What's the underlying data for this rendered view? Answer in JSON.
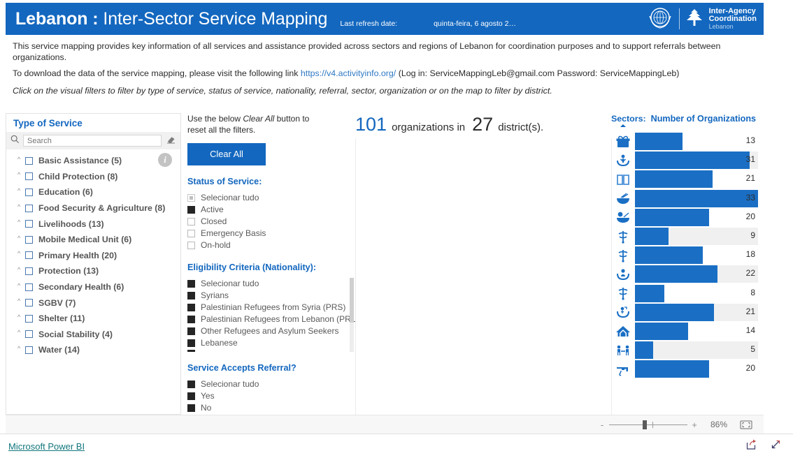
{
  "header": {
    "title_bold": "Lebanon :",
    "title_light": "Inter-Sector Service Mapping",
    "refresh_label": "Last refresh date:",
    "refresh_value": "quinta-feira, 6 agosto 2…",
    "logo": {
      "line1": "Inter-Agency",
      "line2": "Coordination",
      "line3": "Lebanon"
    },
    "accent_color": "#1367bf"
  },
  "intro": {
    "paragraph1": "This service mapping provides key information of all services and assistance provided across sectors and regions of Lebanon for coordination purposes and to support referrals between organizations.",
    "paragraph2_prefix": "To download the data of the service mapping, please visit the following link ",
    "paragraph2_link": "https://v4.activityinfo.org/",
    "paragraph2_suffix": " (Log in: ServiceMappingLeb@gmail.com Password: ServiceMappingLeb)",
    "paragraph3": "Click on the visual filters to filter by type of service, status of service, nationality, referral, sector, organization or on the map to filter by district."
  },
  "type_of_service": {
    "title": "Type of Service",
    "search_placeholder": "Search",
    "search_value": "",
    "info_glyph": "i",
    "items": [
      {
        "label": "Basic Assistance (5)",
        "checked": false
      },
      {
        "label": "Child Protection (8)",
        "checked": false
      },
      {
        "label": "Education (6)",
        "checked": false
      },
      {
        "label": "Food Security & Agriculture (8)",
        "checked": false
      },
      {
        "label": "Livelihoods (13)",
        "checked": false
      },
      {
        "label": "Mobile Medical Unit (6)",
        "checked": false
      },
      {
        "label": "Primary Health (20)",
        "checked": false
      },
      {
        "label": "Protection (13)",
        "checked": false
      },
      {
        "label": "Secondary Health (6)",
        "checked": false
      },
      {
        "label": "SGBV (7)",
        "checked": false
      },
      {
        "label": "Shelter (11)",
        "checked": false
      },
      {
        "label": "Social Stability (4)",
        "checked": false
      },
      {
        "label": "Water (14)",
        "checked": false
      }
    ]
  },
  "filters": {
    "hint_prefix": "Use the below ",
    "hint_italic": "Clear All",
    "hint_suffix": " button to reset all the filters.",
    "clear_all_label": "Clear All",
    "status": {
      "title": "Status of Service:",
      "options": [
        {
          "label": "Selecionar tudo",
          "state": "partial"
        },
        {
          "label": "Active",
          "state": "checked"
        },
        {
          "label": "Closed",
          "state": "unchecked"
        },
        {
          "label": "Emergency Basis",
          "state": "unchecked"
        },
        {
          "label": "On-hold",
          "state": "unchecked"
        }
      ]
    },
    "nationality": {
      "title": "Eligibility Criteria (Nationality):",
      "options": [
        {
          "label": "Selecionar tudo",
          "state": "checked"
        },
        {
          "label": "Syrians",
          "state": "checked"
        },
        {
          "label": "Palestinian Refugees from Syria (PRS)",
          "state": "checked"
        },
        {
          "label": "Palestinian Refugees from Lebanon (PRL)",
          "state": "checked"
        },
        {
          "label": "Other Refugees and Asylum Seekers",
          "state": "checked"
        },
        {
          "label": "Lebanese",
          "state": "checked"
        }
      ]
    },
    "referral": {
      "title": "Service Accepts Referral?",
      "options": [
        {
          "label": "Selecionar tudo",
          "state": "checked"
        },
        {
          "label": "Yes",
          "state": "checked"
        },
        {
          "label": "No",
          "state": "checked"
        }
      ]
    }
  },
  "stats": {
    "organizations_count": "101",
    "organizations_word": "organizations in",
    "districts_count": "27",
    "districts_word": "district(s)."
  },
  "chart_data": {
    "type": "bar",
    "title": "Number of Organizations",
    "sectors_label": "Sectors:",
    "xlabel": "",
    "ylabel": "Sectors",
    "orientation": "horizontal",
    "grid": false,
    "legend": "none",
    "xlim": [
      0,
      33
    ],
    "categories": [
      "Basic Assistance",
      "Child Protection",
      "Education",
      "Food Security & Agriculture",
      "Livelihoods",
      "Mobile Medical Unit",
      "Primary Health",
      "Protection",
      "Secondary Health",
      "SGBV",
      "Shelter",
      "Social Stability",
      "Water"
    ],
    "icons": [
      "basic-assistance-box-icon",
      "child-protection-hands-icon",
      "education-book-icon",
      "food-security-bowl-icon",
      "livelihoods-bowl-coin-icon",
      "mobile-medical-unit-icon",
      "primary-health-caduceus-icon",
      "protection-hands-person-icon",
      "secondary-health-caduceus-icon",
      "sgbv-hands-gender-icon",
      "shelter-house-icon",
      "social-stability-people-icon",
      "water-tap-icon"
    ],
    "values": [
      13,
      31,
      21,
      33,
      20,
      9,
      18,
      22,
      8,
      21,
      14,
      5,
      20
    ]
  },
  "zoombar": {
    "minus": "-",
    "plus": "+",
    "percent": "86%",
    "fit_icon": "fit-to-page-icon"
  },
  "footer": {
    "powerbi_label": "Microsoft Power BI",
    "share_icon": "share-icon",
    "fullscreen_icon": "fullscreen-icon"
  }
}
